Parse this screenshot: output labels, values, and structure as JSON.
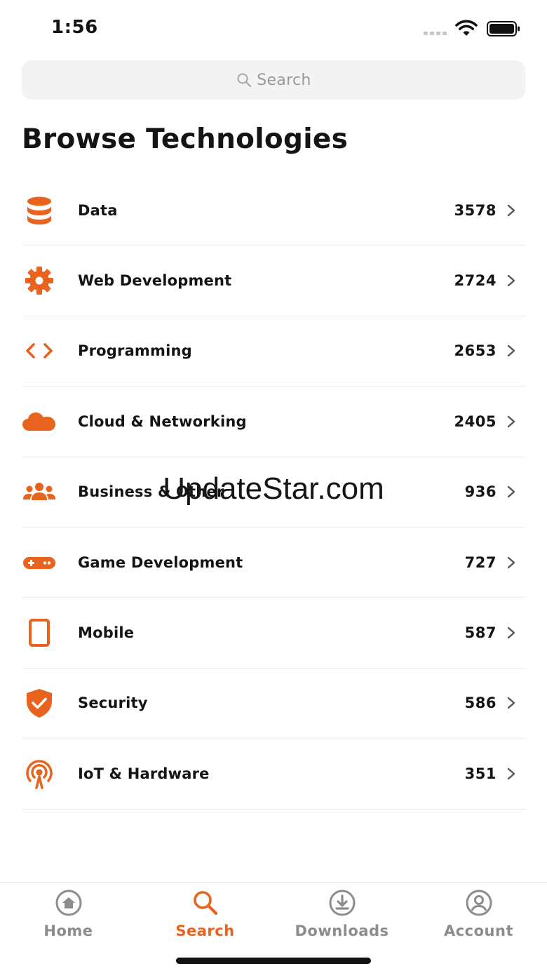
{
  "status_bar": {
    "time": "1:56"
  },
  "search": {
    "placeholder": "Search"
  },
  "page_title": "Browse Technologies",
  "accent_color": "#e8641e",
  "categories": [
    {
      "label": "Data",
      "count": "3578",
      "icon": "database-icon"
    },
    {
      "label": "Web Development",
      "count": "2724",
      "icon": "gear-icon"
    },
    {
      "label": "Programming",
      "count": "2653",
      "icon": "code-brackets-icon"
    },
    {
      "label": "Cloud & Networking",
      "count": "2405",
      "icon": "cloud-icon"
    },
    {
      "label": "Business & Other",
      "count": "936",
      "icon": "people-group-icon"
    },
    {
      "label": "Game Development",
      "count": "727",
      "icon": "gamepad-icon"
    },
    {
      "label": "Mobile",
      "count": "587",
      "icon": "tablet-icon"
    },
    {
      "label": "Security",
      "count": "586",
      "icon": "shield-check-icon"
    },
    {
      "label": "IoT & Hardware",
      "count": "351",
      "icon": "broadcast-icon"
    }
  ],
  "watermark": "UpdateStar.com",
  "tabs": [
    {
      "label": "Home",
      "icon": "home-icon",
      "active": false
    },
    {
      "label": "Search",
      "icon": "search-icon",
      "active": true
    },
    {
      "label": "Downloads",
      "icon": "download-icon",
      "active": false
    },
    {
      "label": "Account",
      "icon": "account-icon",
      "active": false
    }
  ]
}
